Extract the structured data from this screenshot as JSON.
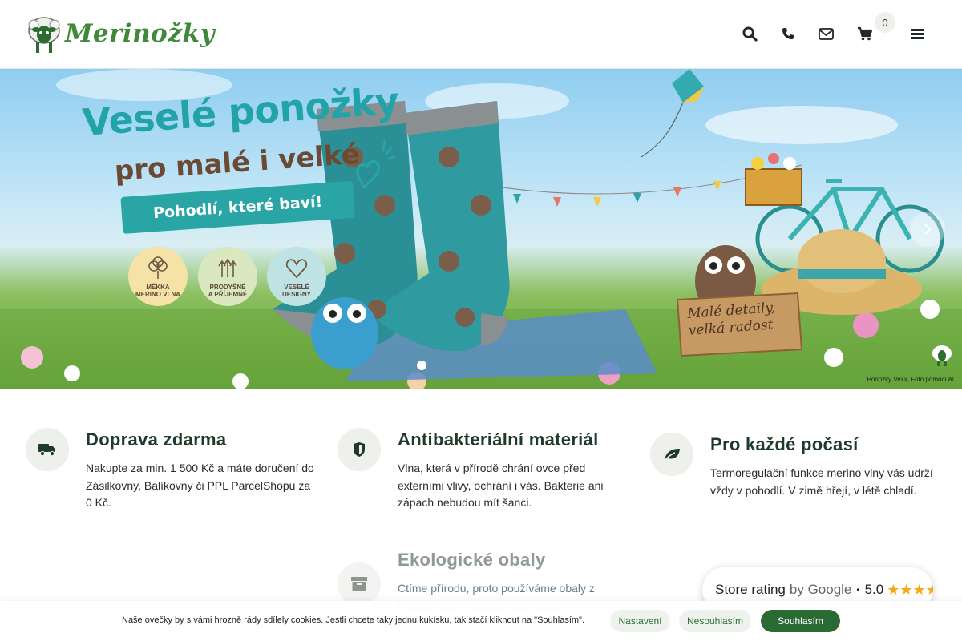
{
  "header": {
    "logo_text": "Merinožky",
    "cart_count": "0"
  },
  "hero": {
    "title": "Veselé ponožky",
    "subtitle": "pro malé i velké",
    "tagline": "Pohodlí, které baví!",
    "badges": [
      {
        "line1": "MĚKKÁ",
        "line2": "MERINO VLNA"
      },
      {
        "line1": "PRODYŠNÉ",
        "line2": "A PŘÍJEMNÉ"
      },
      {
        "line1": "VESELÉ",
        "line2": "DESIGNY"
      }
    ],
    "sign_line1": "Malé detaily,",
    "sign_line2": "velká radost",
    "ai_note": "Ponožky Vexx, Foto pomocí AI",
    "slide_count": 1,
    "active_slide": 1
  },
  "features": [
    {
      "title": "Doprava zdarma",
      "text": "Nakupte za min. 1 500 Kč a máte doručení do Zásilkovny, Balíkovny či PPL ParcelShopu za 0 Kč.",
      "icon": "truck-icon"
    },
    {
      "title": "Antibakteriální materiál",
      "text": "Vlna, která v přírodě chrání ovce před externími vlivy, ochrání i vás. Bakterie ani zápach nebudou mít šanci.",
      "icon": "shield-icon"
    },
    {
      "title": "Pro každé počasí",
      "text": "Termoregulační funkce merino vlny vás udrží vždy v pohodlí. V zimě hřejí, v létě chladí.",
      "icon": "leaf-icon"
    },
    {
      "title": "Ekologické obaly",
      "text": "Ctíme přírodu, proto používáme obaly z recyklovaného plastu nebo kartonu.",
      "icon": "archive-box-icon"
    }
  ],
  "rating": {
    "label": "Store rating",
    "by": "by Google",
    "score": "5.0",
    "stars": "★★★★★"
  },
  "cookie": {
    "text": "Naše ovečky by s vámi hrozně rády sdílely cookies. Jestli chcete taky jednu kukísku, tak stačí kliknout na \"Souhlasím\".",
    "settings_label": "Nastavení",
    "reject_label": "Nesouhlasím",
    "accept_label": "Souhlasím"
  },
  "colors": {
    "brand_green": "#3f8a3a",
    "accept_button": "#2b6a32",
    "hero_teal": "#21a3a8"
  }
}
